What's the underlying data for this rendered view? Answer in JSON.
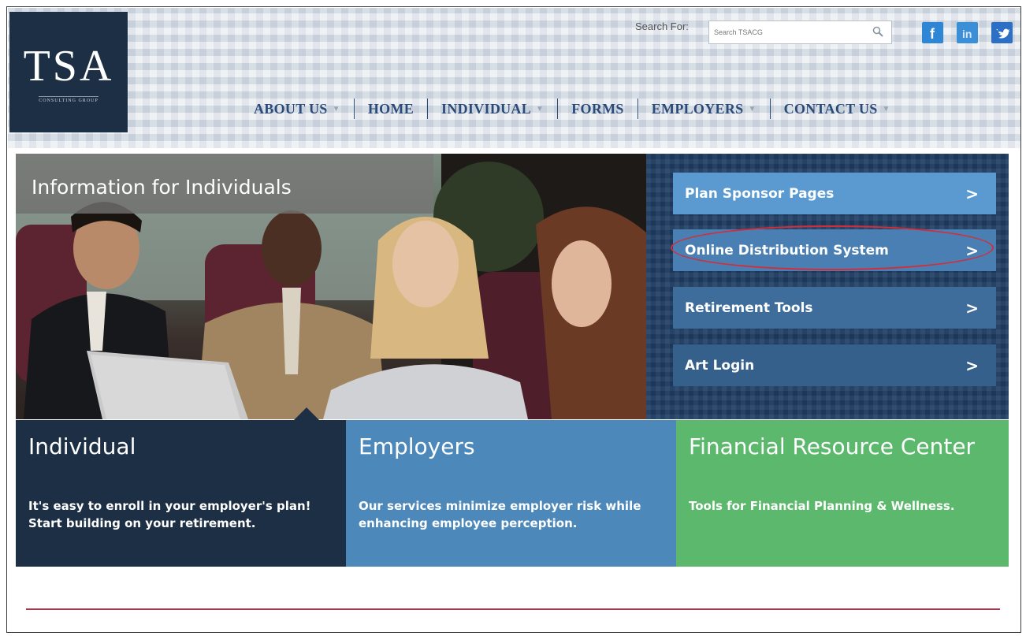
{
  "logo": {
    "title": "TSA",
    "subtitle": "CONSULTING GROUP"
  },
  "search": {
    "label": "Search For:",
    "placeholder": "Search TSACG"
  },
  "social": [
    "facebook-icon",
    "linkedin-icon",
    "twitter-icon"
  ],
  "nav": [
    {
      "label": "ABOUT US",
      "has_menu": true
    },
    {
      "label": "HOME",
      "has_menu": false
    },
    {
      "label": "INDIVIDUAL",
      "has_menu": true
    },
    {
      "label": "FORMS",
      "has_menu": false
    },
    {
      "label": "EMPLOYERS",
      "has_menu": true
    },
    {
      "label": "CONTACT US",
      "has_menu": true
    }
  ],
  "hero": {
    "title": "Information for Individuals"
  },
  "side_buttons": [
    {
      "label": "Plan Sponsor Pages"
    },
    {
      "label": "Online Distribution System",
      "highlighted": true
    },
    {
      "label": "Retirement Tools"
    },
    {
      "label": "Art Login"
    }
  ],
  "tiles": [
    {
      "title": "Individual",
      "text": "It's easy to enroll in your employer's plan! Start building on your retirement."
    },
    {
      "title": "Employers",
      "text": "Our services minimize employer risk while enhancing employee perception."
    },
    {
      "title": "Financial Resource Center",
      "text": "Tools for Financial Planning & Wellness."
    }
  ],
  "colors": {
    "navy": "#1c2f45",
    "blue": "#4d88bb",
    "green": "#5bb86c",
    "highlight": "#d42d3a",
    "rule": "#a33a4f"
  }
}
